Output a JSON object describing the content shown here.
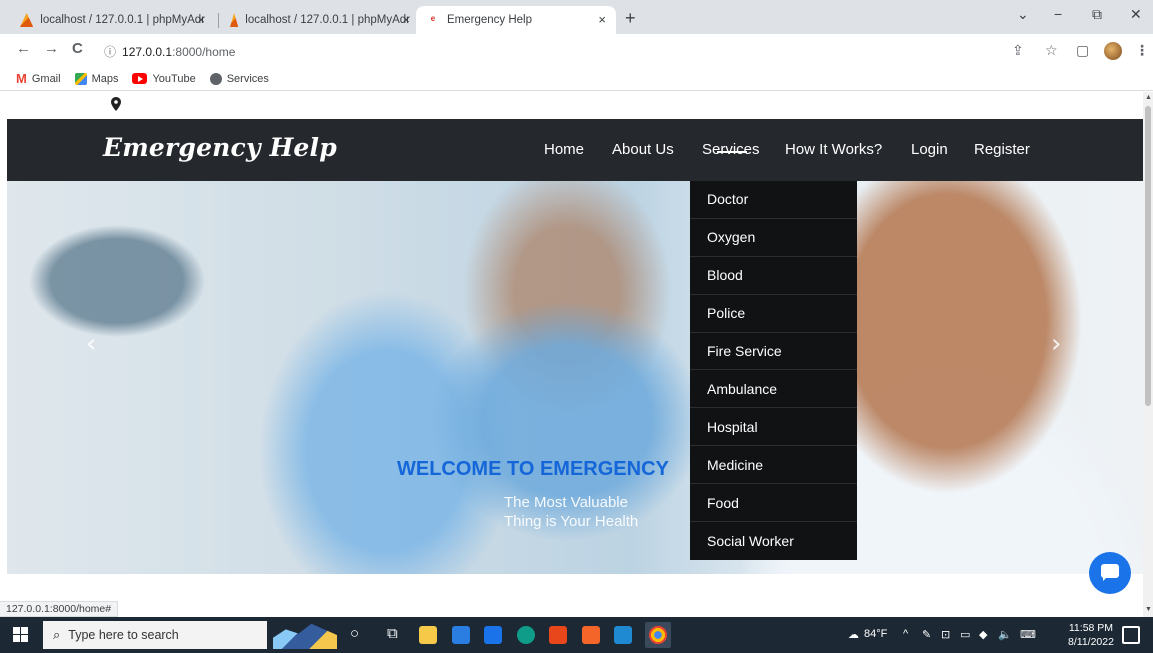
{
  "browser": {
    "tabs": [
      {
        "title": "localhost / 127.0.0.1 | phpMyAdr",
        "close": "×"
      },
      {
        "title": "localhost / 127.0.0.1 | phpMyAdr",
        "close": "×"
      },
      {
        "title": "Emergency Help",
        "close": "×"
      }
    ],
    "new_tab": "+",
    "window_controls": {
      "minimize": "−",
      "maximize": "⧉",
      "close": "✕",
      "dropdown": "⌄"
    },
    "nav": {
      "back": "←",
      "forward": "→",
      "reload": "C"
    },
    "address": {
      "info": "ⓘ",
      "host": "127.0.0.1",
      "path": ":8000/home"
    },
    "toolbar_icons": {
      "share": "⇪",
      "star": "☆",
      "sidebar": "▢",
      "menu": "⋮"
    },
    "bookmarks": [
      {
        "label": "Gmail",
        "icon": "gmail-icon"
      },
      {
        "label": "Maps",
        "icon": "maps-icon"
      },
      {
        "label": "YouTube",
        "icon": "youtube-icon"
      },
      {
        "label": "Services",
        "icon": "globe-icon"
      }
    ],
    "status_url": "127.0.0.1:8000/home#"
  },
  "site": {
    "brand": "Emergency Help",
    "menu": [
      {
        "label": "Home"
      },
      {
        "label": "About Us"
      },
      {
        "label": "Services",
        "active": true
      },
      {
        "label": "How It Works?"
      },
      {
        "label": "Login"
      },
      {
        "label": "Register"
      }
    ],
    "services_dropdown": [
      "Doctor",
      "Oxygen",
      "Blood",
      "Police",
      "Fire Service",
      "Ambulance",
      "Hospital",
      "Medicine",
      "Food",
      "Social Worker"
    ],
    "hero": {
      "welcome": "WELCOME TO EMERGENCY",
      "tagline_1": "The Most Valuable",
      "tagline_2": "Thing is Your Health",
      "prev": "‹",
      "next": "›"
    },
    "colors": {
      "header_bg": "#25282d",
      "accent_blue": "#1566d8",
      "dropdown_bg": "#111214"
    }
  },
  "taskbar": {
    "search_placeholder": "Type here to search",
    "weather": "84°F",
    "tray": "^",
    "time": "11:58 PM",
    "date": "8/11/2022"
  }
}
